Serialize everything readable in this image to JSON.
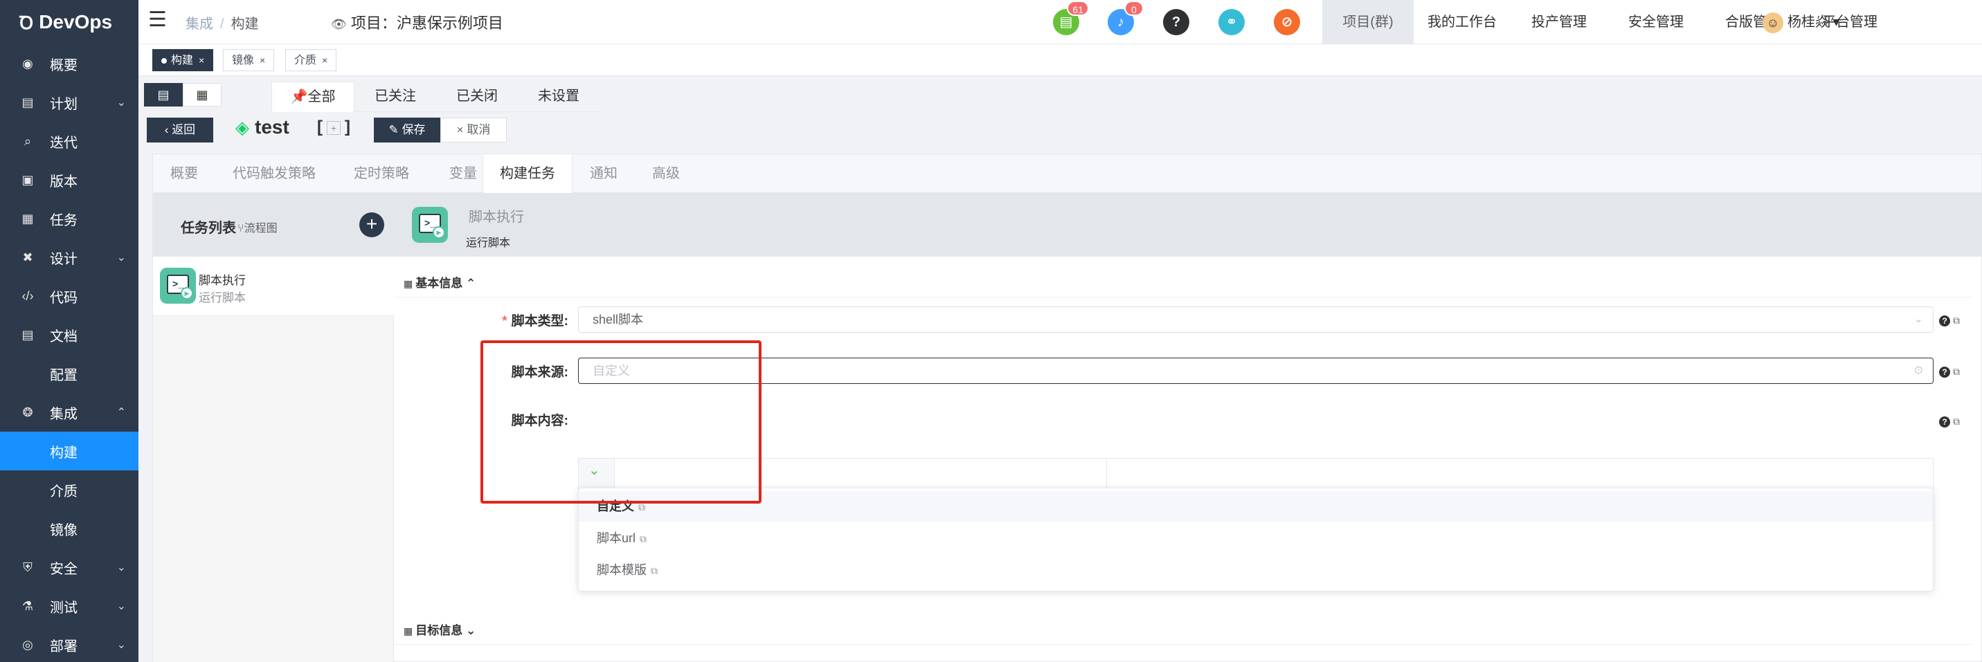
{
  "app": {
    "name": "DevOps"
  },
  "sidebar": {
    "items": [
      {
        "label": "概要",
        "icon": "dashboard-icon"
      },
      {
        "label": "计划",
        "icon": "plan-icon",
        "expand": true
      },
      {
        "label": "迭代",
        "icon": "iteration-icon"
      },
      {
        "label": "版本",
        "icon": "version-icon"
      },
      {
        "label": "任务",
        "icon": "task-icon"
      },
      {
        "label": "设计",
        "icon": "design-icon",
        "expand": true
      },
      {
        "label": "代码",
        "icon": "code-icon"
      },
      {
        "label": "文档",
        "icon": "document-icon"
      },
      {
        "label": "配置"
      },
      {
        "label": "集成",
        "icon": "integration-icon",
        "expand": true
      },
      {
        "label": "构建",
        "active": true
      },
      {
        "label": "介质"
      },
      {
        "label": "镜像"
      },
      {
        "label": "安全",
        "icon": "security-icon",
        "expand": true
      },
      {
        "label": "测试",
        "icon": "test-icon",
        "expand": true
      },
      {
        "label": "部署",
        "icon": "deploy-icon",
        "expand": true
      }
    ]
  },
  "header": {
    "breadcrumb": [
      "集成",
      "构建"
    ],
    "project_label": "项目：沪惠保示例项目",
    "badges": {
      "todo": "61",
      "notify": "0"
    },
    "nav": [
      "项目(群)",
      "我的工作台",
      "投产管理",
      "安全管理",
      "合版管理",
      "平台管理"
    ],
    "user": "杨桂焱"
  },
  "tags": [
    {
      "label": "构建",
      "active": true
    },
    {
      "label": "镜像"
    },
    {
      "label": "介质"
    }
  ],
  "filter_tabs": [
    "全部",
    "已关注",
    "已关闭",
    "未设置"
  ],
  "actions": {
    "back": "返回",
    "pipeline_name": "test",
    "bracket_open": "[",
    "bracket_close": "]",
    "save": "保存",
    "cancel": "取消"
  },
  "config_tabs": [
    "概要",
    "代码触发策略",
    "定时策略",
    "变量",
    "构建任务",
    "通知",
    "高级"
  ],
  "task_list": {
    "title": "任务列表",
    "flow_link": "流程图",
    "items": [
      {
        "name": "脚本执行",
        "desc": "运行脚本"
      }
    ]
  },
  "detail": {
    "title": "脚本执行",
    "subtitle": "运行脚本",
    "section_basic": "基本信息",
    "section_target": "目标信息",
    "script_type_label": "脚本类型:",
    "script_type_value": "shell脚本",
    "script_source_label": "脚本来源:",
    "script_source_placeholder": "自定义",
    "script_content_label": "脚本内容:"
  },
  "dropdown": {
    "options": [
      "自定义",
      "脚本url",
      "脚本模版"
    ],
    "selected": "自定义"
  },
  "colors": {
    "sidebar": "#2d3a4b",
    "active": "#1890ff",
    "highlight": "#e0261a"
  }
}
